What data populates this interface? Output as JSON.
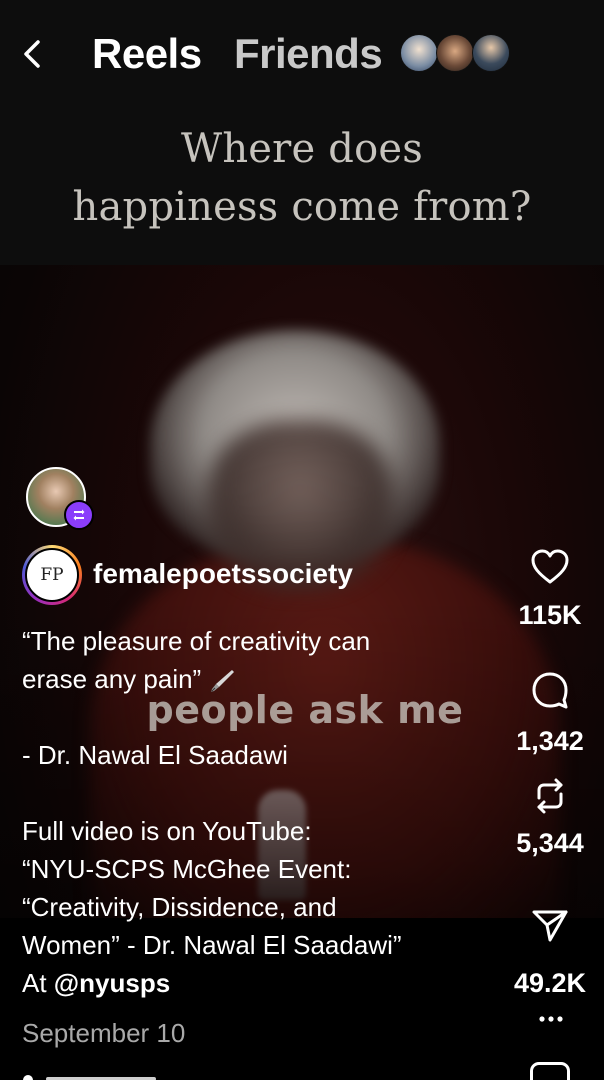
{
  "header": {
    "tabs": [
      {
        "label": "Reels",
        "active": true
      },
      {
        "label": "Friends",
        "active": false
      }
    ]
  },
  "video": {
    "headline_lines": [
      "Where does",
      "happiness come from?"
    ],
    "overlay_caption": "people ask me"
  },
  "post": {
    "account_avatar_text": "FP",
    "username": "femalepoetssociety",
    "caption_lines": [
      "“The pleasure of creativity can",
      "erase any pain”",
      "",
      "- Dr. Nawal El Saadawi",
      "",
      "Full video is on YouTube:",
      "“NYU-SCPS McGhee Event:",
      "“Creativity, Dissidence, and",
      "Women” - Dr. Nawal El Saadawi”"
    ],
    "mention_prefix": "At ",
    "mention": "@nyusps",
    "date": "September 10"
  },
  "actions": {
    "likes": "115K",
    "comments": "1,342",
    "reposts": "5,344",
    "shares": "49.2K"
  },
  "icons": {
    "back": "chevron-left-icon",
    "like": "heart-icon",
    "comment": "comment-bubble-icon",
    "repost": "repost-icon",
    "share": "send-icon",
    "more": "more-dots-icon",
    "remix": "repost-badge-icon",
    "pen": "fountain-pen-icon"
  },
  "colors": {
    "background": "#000000",
    "text": "#ffffff",
    "muted": "#a9a9a9",
    "remix_badge": "#8a3dfb"
  }
}
